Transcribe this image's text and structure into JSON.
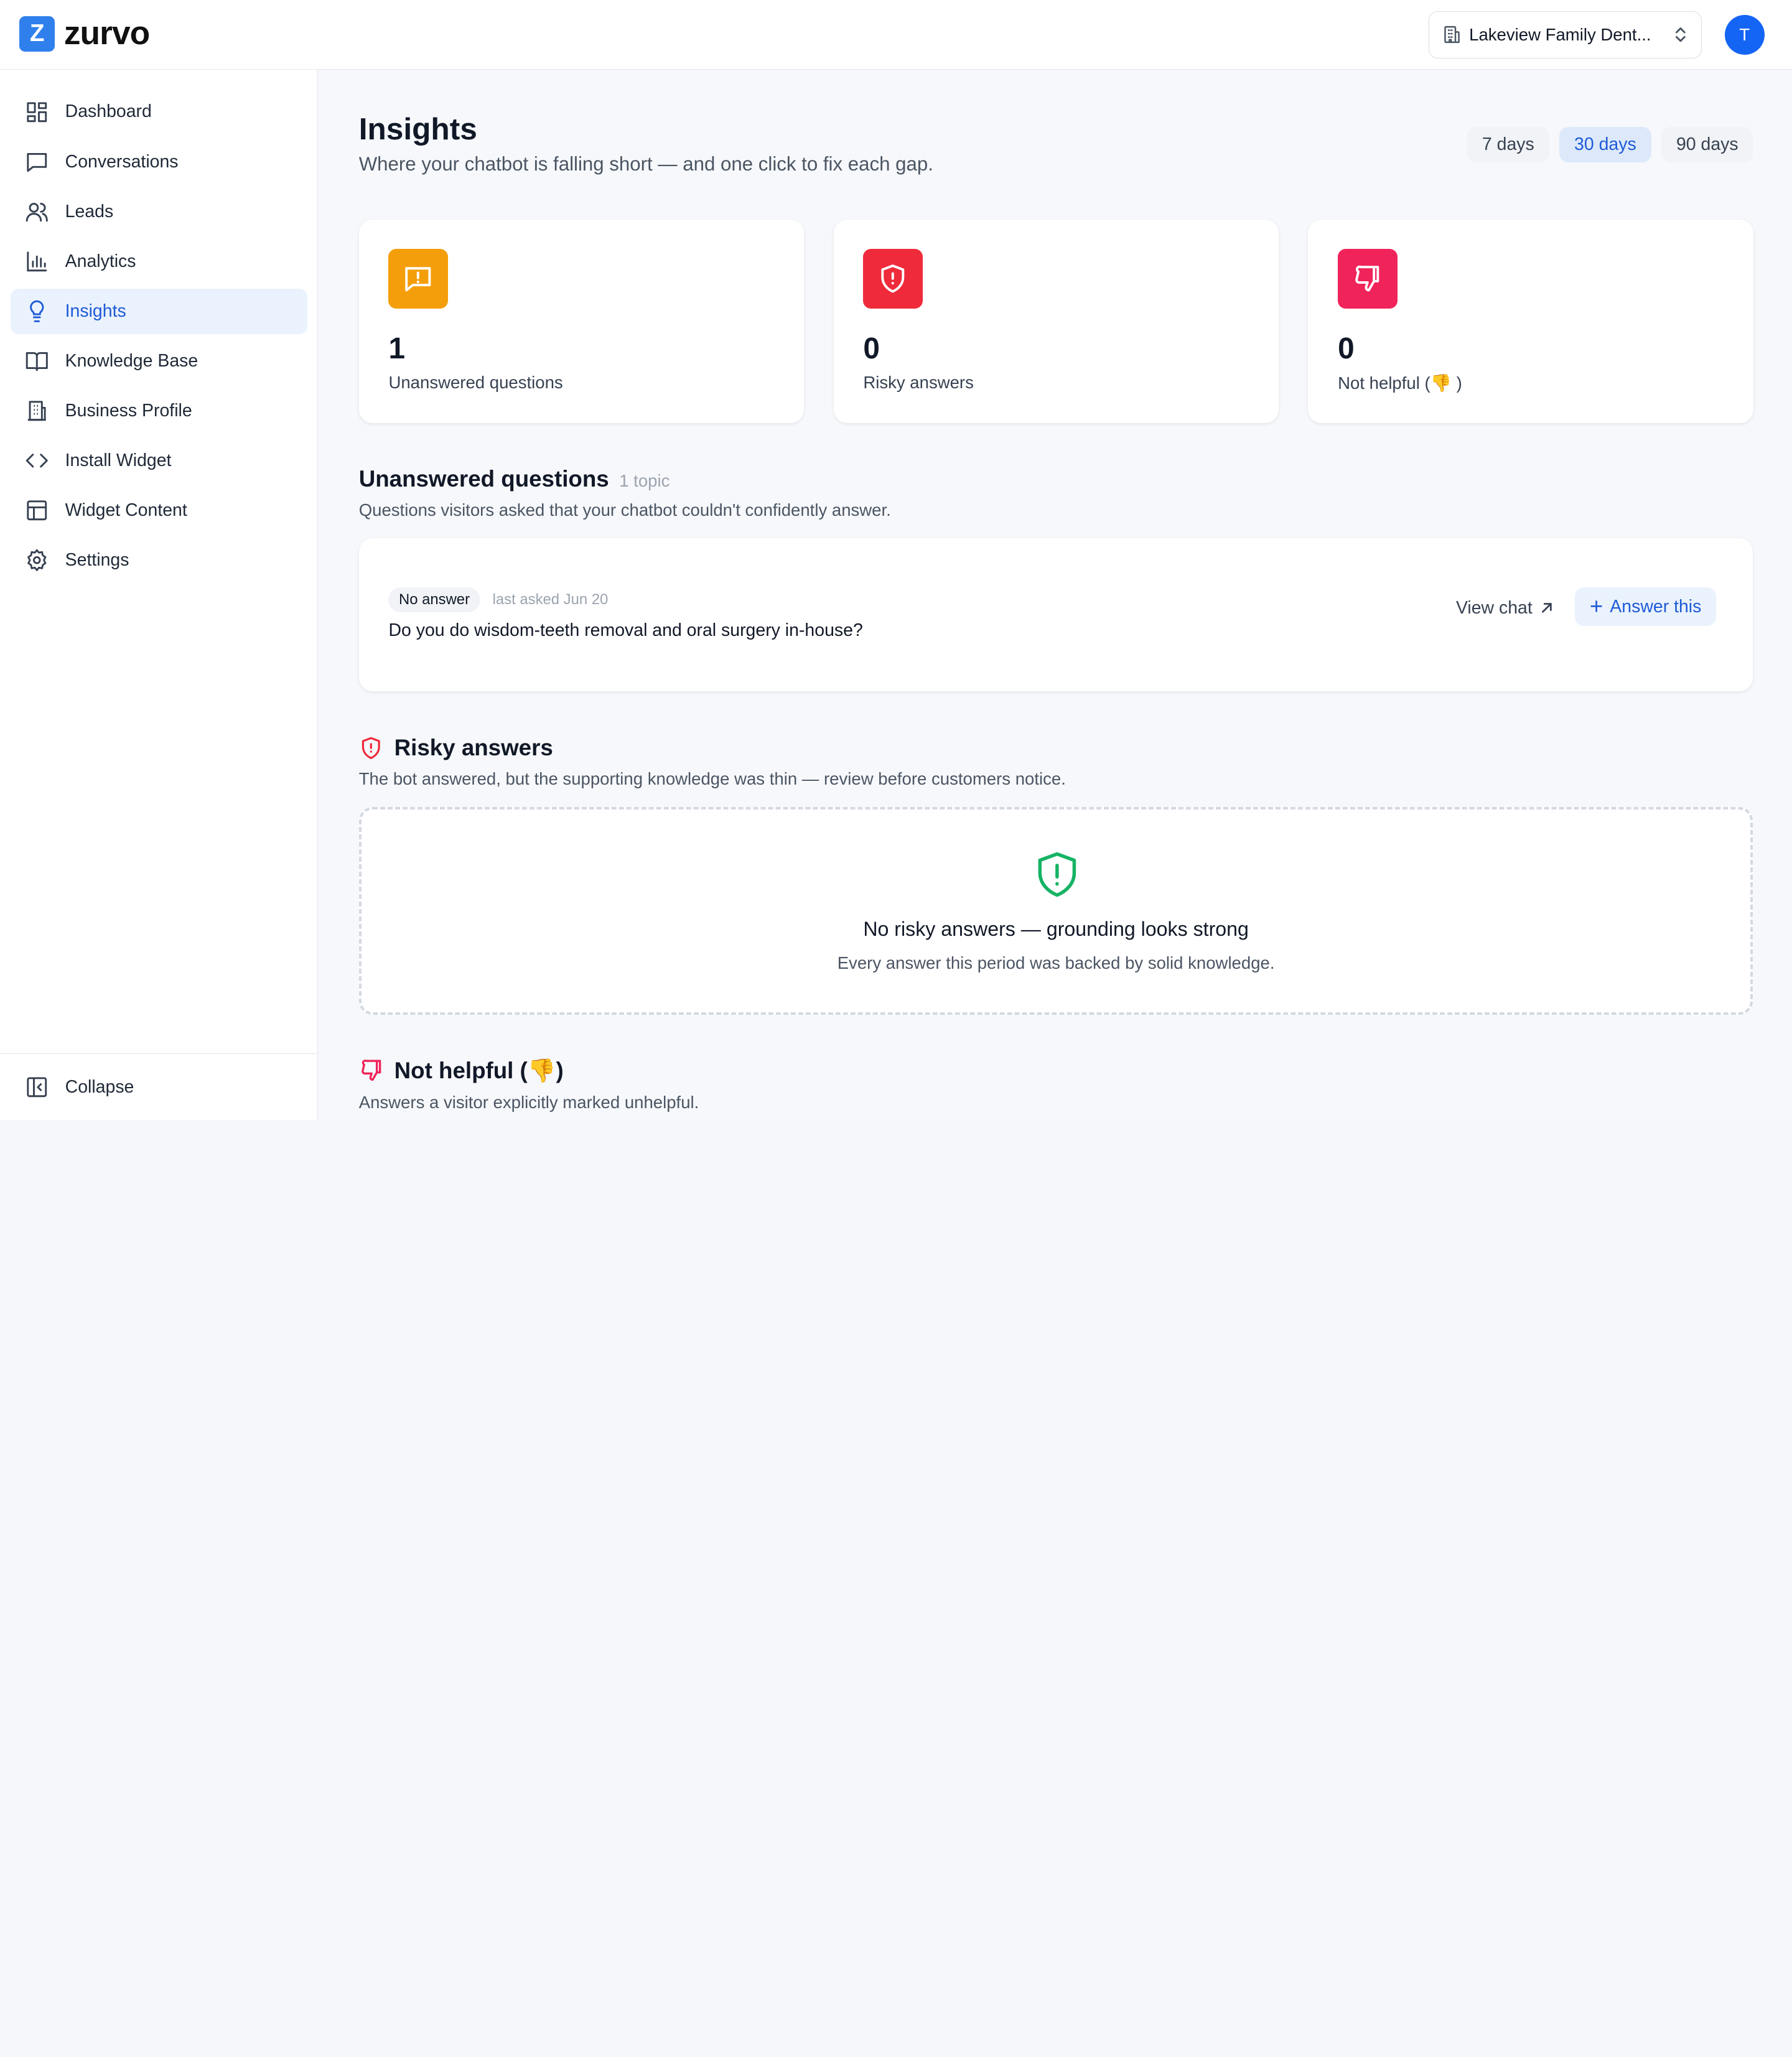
{
  "app": {
    "logo_letter": "Z",
    "logo_text": "zurvo",
    "business_name": "Lakeview Family Dent...",
    "avatar_initial": "T"
  },
  "sidebar": {
    "items": [
      {
        "label": "Dashboard",
        "icon": "dashboard-icon"
      },
      {
        "label": "Conversations",
        "icon": "chat-icon"
      },
      {
        "label": "Leads",
        "icon": "users-icon"
      },
      {
        "label": "Analytics",
        "icon": "bar-chart-icon"
      },
      {
        "label": "Insights",
        "icon": "lightbulb-icon",
        "active": true
      },
      {
        "label": "Knowledge Base",
        "icon": "book-icon"
      },
      {
        "label": "Business Profile",
        "icon": "building-icon"
      },
      {
        "label": "Install Widget",
        "icon": "code-icon"
      },
      {
        "label": "Widget Content",
        "icon": "layout-icon"
      },
      {
        "label": "Settings",
        "icon": "gear-icon"
      }
    ],
    "collapse_label": "Collapse"
  },
  "page": {
    "title": "Insights",
    "subtitle": "Where your chatbot is falling short — and one click to fix each gap.",
    "ranges": [
      "7 days",
      "30 days",
      "90 days"
    ],
    "active_range": "30 days"
  },
  "stats": [
    {
      "value": "1",
      "label": "Unanswered questions",
      "color": "#f59e0b",
      "icon": "message-alert-icon"
    },
    {
      "value": "0",
      "label": "Risky answers",
      "color": "#ef2b3b",
      "icon": "shield-alert-icon"
    },
    {
      "value": "0",
      "label": "Not helpful (👎 )",
      "color": "#f0235a",
      "icon": "thumbs-down-icon"
    }
  ],
  "unanswered": {
    "title": "Unanswered questions",
    "count": "1 topic",
    "description": "Questions visitors asked that your chatbot couldn't confidently answer.",
    "items": [
      {
        "badge": "No answer",
        "meta": "last asked Jun 20",
        "question": "Do you do wisdom-teeth removal and oral surgery in-house?",
        "view_chat_label": "View chat",
        "answer_label": "Answer this"
      }
    ]
  },
  "risky": {
    "title": "Risky answers",
    "description": "The bot answered, but the supporting knowledge was thin — review before customers notice.",
    "empty_title": "No risky answers — grounding looks strong",
    "empty_desc": "Every answer this period was backed by solid knowledge."
  },
  "not_helpful": {
    "title": "Not helpful (👎)",
    "description": "Answers a visitor explicitly marked unhelpful."
  },
  "colors": {
    "accent": "#1f5bd6",
    "brand": "#2f80ed",
    "success": "#16b364",
    "danger": "#ef2b3b"
  }
}
